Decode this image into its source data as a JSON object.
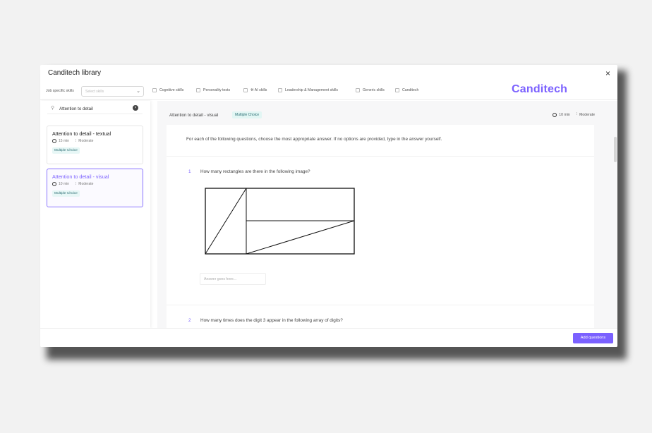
{
  "modal": {
    "title": "Canditech library",
    "close": "×"
  },
  "filters": {
    "job_label": "Job specific skills",
    "select_placeholder": "Select skills",
    "checkboxes": [
      "Cognitive skills",
      "Personality tests",
      "⚒ AI skills",
      "Leadership & Management skills",
      "Generic skills",
      "Canditech"
    ]
  },
  "brand": "Canditech",
  "search": {
    "value": "Attention to detail"
  },
  "cards": [
    {
      "title": "Attention to detail - textual",
      "time": "15 min",
      "level": "Moderate",
      "type": "Multiple Choice"
    },
    {
      "title": "Attention to detail - visual",
      "time": "10 min",
      "level": "Moderate",
      "type": "Multiple Choice"
    }
  ],
  "detail": {
    "title": "Attention to detail - visual",
    "type": "Multiple Choice",
    "time": "10 min",
    "level": "Moderate",
    "instructions": "For each of the following questions, choose the most appropriate answer. If no options are provided, type in the answer yourself.",
    "questions": [
      {
        "num": "1",
        "text": "How many rectangles are there in the following image?",
        "answer_placeholder": "Answer goes here..."
      },
      {
        "num": "2",
        "text": "How many times does the digit 3 appear in the following array of digits?"
      }
    ]
  },
  "footer": {
    "add_label": "Add questions"
  },
  "colors": {
    "accent": "#7b61ff",
    "badge_bg": "#e7f7f6",
    "badge_text": "#2b6d73"
  }
}
